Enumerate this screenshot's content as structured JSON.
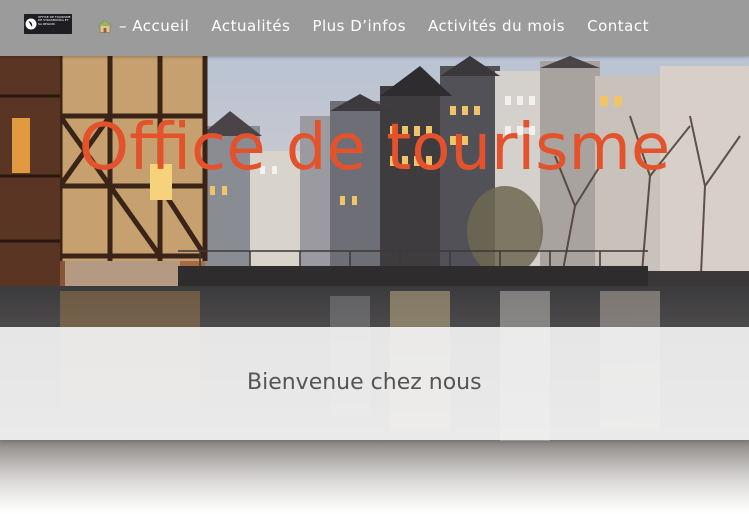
{
  "header": {
    "logo_text": "OFFICE DE TOURISME DE STRASBOURG ET SA REGION",
    "nav": [
      {
        "label": "– Accueil",
        "icon": "house-icon"
      },
      {
        "label": "Actualités"
      },
      {
        "label": "Plus D’infos"
      },
      {
        "label": "Activités du mois"
      },
      {
        "label": "Contact"
      }
    ]
  },
  "hero": {
    "title": "Office de tourisme",
    "title_color": "#e4522c"
  },
  "welcome": {
    "text": "Bienvenue chez nous"
  },
  "colors": {
    "header_bg": "#9b9b9b",
    "welcome_bg": "#f2f2f2",
    "welcome_text": "#555555"
  }
}
